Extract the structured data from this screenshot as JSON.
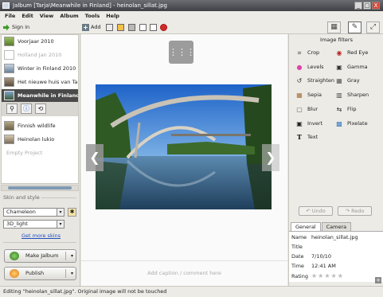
{
  "window": {
    "title": "Jalbum [Tarja\\Meanwhile in Finland] - heinolan_sillat.jpg",
    "minimize": "_",
    "maximize": "□",
    "close": "X"
  },
  "menu": [
    "File",
    "Edit",
    "View",
    "Album",
    "Tools",
    "Help"
  ],
  "toolbar": {
    "signin_label": "Sign in",
    "add_label": "Add"
  },
  "projects": [
    {
      "name": "Voorjaar 2010",
      "state": "normal"
    },
    {
      "name": "Holland Jan 2010",
      "state": "dim"
    },
    {
      "name": "Winter in Finland 2010",
      "state": "normal"
    },
    {
      "name": "Het nieuwe huis van Tarja",
      "state": "normal"
    },
    {
      "name": "Meanwhile in Finland",
      "state": "selected"
    },
    {
      "name": "Finnish wildlife",
      "state": "normal"
    },
    {
      "name": "Heinolan lukio",
      "state": "normal"
    },
    {
      "name": "Empty Project",
      "state": "dim"
    }
  ],
  "skin": {
    "section_label": "Skin and style",
    "skin_value": "Chameleon",
    "style_value": "3D_light",
    "more_skins_link": "Get more skins"
  },
  "actions": {
    "make_label": "Make Jalbum",
    "publish_label": "Publish"
  },
  "viewer": {
    "prev": "❮",
    "next": "❯",
    "grid_icon": "⋮⋮⋮",
    "caption_placeholder": "Add caption / comment here"
  },
  "filters": {
    "title": "Image filters",
    "items": [
      {
        "label": "Crop",
        "icon": "⌗",
        "color": "#333"
      },
      {
        "label": "Red Eye",
        "icon": "◉",
        "color": "#b22"
      },
      {
        "label": "Levels",
        "icon": "●",
        "color": "#d4a"
      },
      {
        "label": "Gamma",
        "icon": "▣",
        "color": "#333"
      },
      {
        "label": "Straighten",
        "icon": "↺",
        "color": "#333"
      },
      {
        "label": "Gray",
        "icon": "▦",
        "color": "#555"
      },
      {
        "label": "Sepia",
        "icon": "▦",
        "color": "#a3703b"
      },
      {
        "label": "Sharpen",
        "icon": "▥",
        "color": "#444"
      },
      {
        "label": "Blur",
        "icon": "▢",
        "color": "#666"
      },
      {
        "label": "Flip",
        "icon": "⇆",
        "color": "#333"
      },
      {
        "label": "Invert",
        "icon": "▣",
        "color": "#222"
      },
      {
        "label": "Pixelate",
        "icon": "▩",
        "color": "#3a7bbf"
      },
      {
        "label": "Text",
        "icon": "T",
        "color": "#111"
      }
    ],
    "undo": "Undo",
    "redo": "Redo"
  },
  "details": {
    "tabs": [
      "General",
      "Camera"
    ],
    "name_label": "Name",
    "name_value": "heinolan_sillat.jpg",
    "title_label": "Title",
    "date_label": "Date",
    "date_value": "7/10/10",
    "time_label": "Time",
    "time_value": "12:41 AM",
    "rating_label": "Rating",
    "rating_stars": "★★★★★"
  },
  "status": "Editing \"heinolan_sillat.jpg\". Original image will not be touched"
}
